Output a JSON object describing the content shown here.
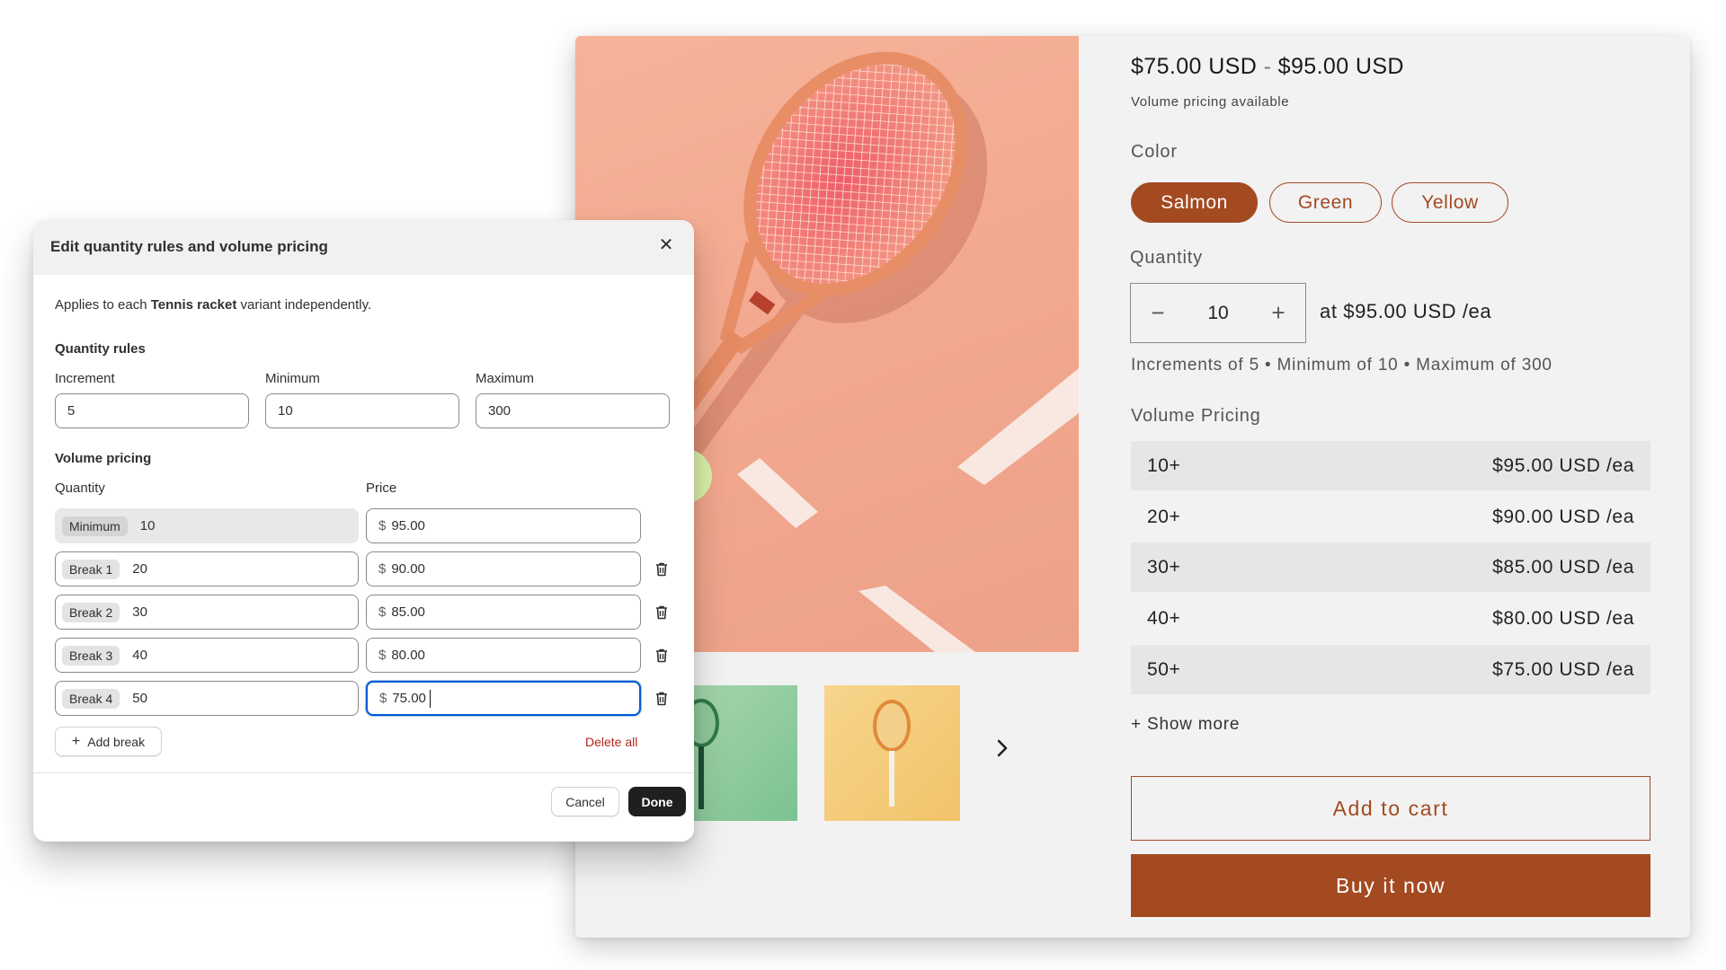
{
  "product": {
    "price_low": "$75.00 USD",
    "price_separator": "-",
    "price_high": "$95.00 USD",
    "volume_note": "Volume pricing available",
    "color_label": "Color",
    "colors": [
      "Salmon",
      "Green",
      "Yellow"
    ],
    "selected_color": "Salmon",
    "quantity_label": "Quantity",
    "quantity_value": "10",
    "quantity_minus": "−",
    "quantity_plus": "+",
    "unit_price_text": "at  $95.00 USD /ea",
    "increments_text": "Increments of 5 • Minimum of 10 • Maximum of 300",
    "volume_pricing_label": "Volume Pricing",
    "tiers": [
      {
        "qty": "10+",
        "price": "$95.00 USD /ea"
      },
      {
        "qty": "20+",
        "price": "$90.00 USD /ea"
      },
      {
        "qty": "30+",
        "price": "$85.00 USD /ea"
      },
      {
        "qty": "40+",
        "price": "$80.00 USD /ea"
      },
      {
        "qty": "50+",
        "price": "$75.00 USD /ea"
      }
    ],
    "show_more": "+ Show more",
    "add_to_cart": "Add to cart",
    "buy_now": "Buy it now",
    "thumbnails": [
      "green-racket-thumbnail",
      "yellow-racket-thumbnail"
    ],
    "next_icon": "chevron-right-icon"
  },
  "modal": {
    "title": "Edit quantity rules and volume pricing",
    "close_icon": "close-icon",
    "intro_prefix": "Applies to each ",
    "intro_product": "Tennis racket",
    "intro_suffix": " variant independently.",
    "quantity_rules_heading": "Quantity rules",
    "increment_label": "Increment",
    "increment_value": "5",
    "minimum_label": "Minimum",
    "minimum_value": "10",
    "maximum_label": "Maximum",
    "maximum_value": "300",
    "volume_pricing_heading": "Volume pricing",
    "quantity_col": "Quantity",
    "price_col": "Price",
    "currency_symbol": "$",
    "rows": [
      {
        "chip": "Minimum",
        "qty": "10",
        "price": "95.00"
      },
      {
        "chip": "Break 1",
        "qty": "20",
        "price": "90.00"
      },
      {
        "chip": "Break 2",
        "qty": "30",
        "price": "85.00"
      },
      {
        "chip": "Break 3",
        "qty": "40",
        "price": "80.00"
      },
      {
        "chip": "Break 4",
        "qty": "50",
        "price": "75.00"
      }
    ],
    "add_break": "Add break",
    "delete_all": "Delete all",
    "cancel": "Cancel",
    "done": "Done"
  },
  "colors": {
    "brand": "#a34a21",
    "focus": "#005bd3",
    "danger": "#b3261e",
    "hero_background": "#f3a98f"
  }
}
